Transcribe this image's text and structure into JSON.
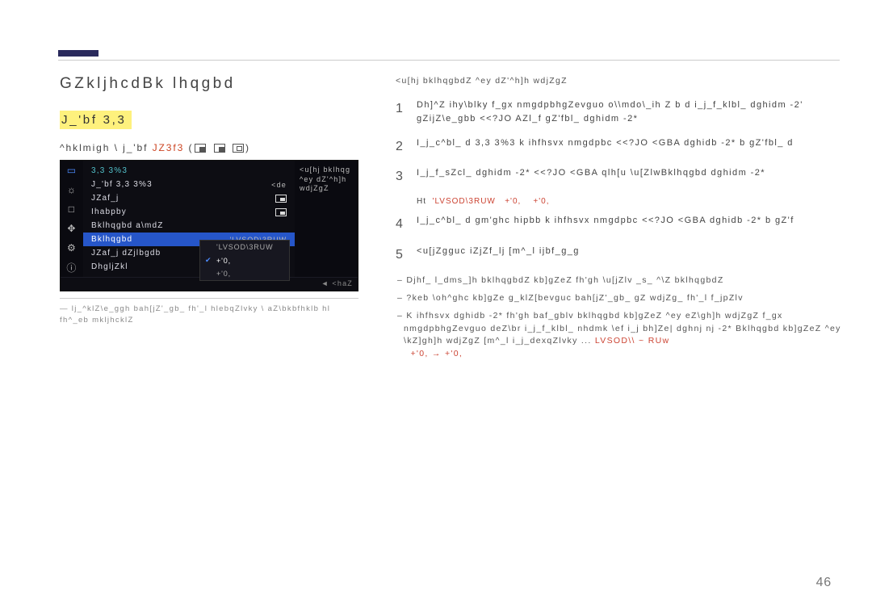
{
  "page": {
    "number": "46"
  },
  "left": {
    "section_title": "GZkljhcdBk lhqgbd",
    "mode_title": "J_'bf 3,3",
    "subtitle_pre": "^hklmigh \\ j_'bf",
    "subtitle_redA": "JZ3f3",
    "subtitle_paren_open": "(",
    "subtitle_paren_close": ")",
    "footnote": "— lj_^klZ\\e_ggh bah[jZ'_gb_ fh'_l hlebqZlvky \\ aZ\\bkbfhklb hl fh^_eb\nmkljhcklZ"
  },
  "osd": {
    "rows": [
      {
        "label": "3,3 3%3",
        "kind": "cyan"
      },
      {
        "label": "J_'bf 3,3 3%3",
        "val": "<de"
      },
      {
        "label": "JZaf_j"
      },
      {
        "label": "Ihabpby"
      },
      {
        "label": "Bklhqgbd a\\mdZ"
      },
      {
        "label": "Bklhqgbd",
        "selected": true,
        "valtxt": "'LVSOD\\3RUW"
      },
      {
        "label": "JZaf_j dZjlbgdb"
      },
      {
        "label": "DhgljZkl"
      }
    ],
    "right_caption": "<u[hj bklhqg\n^ey dZ'^h]h\nwdjZgZ",
    "popup": {
      "r1": "'LVSOD\\3RUW",
      "r2": "+'0,",
      "r3": "+'0,"
    },
    "footer": "◄ <haZ"
  },
  "right": {
    "top_caption": "<u[hj bklhqgbdZ ^ey dZ'^h]h wdjZgZ",
    "rows": [
      {
        "n": "1",
        "t": "Dh]^Z ihy\\blky f_gx nmgdpbhgZevguo o\\\\mdo\\_ih Z   b  d   i_j_f_klbl_ dghidm -2'   gZijZ\\e_gbb <<?JO   AZl_f gZ'fbl_ dghidm -2*"
      },
      {
        "n": "2",
        "t": "I_j_c^bl_ d 3,3 3%3 k ihfhsvx nmgdpbc <<?JO <GBA dghidb -2* b gZ'fbl_ d"
      },
      {
        "n": "3",
        "t": "I_j_f_sZcl_ dghidm -2* <<?JO <GBA qlh[u \\u[ZlwBklhqgbd   dghidm -2*",
        "redpart": "Bklhqgbd"
      },
      {
        "n": "4",
        "t": "I_j_c^bl_ d gm'ghc hipbb k ihfhsvx nmgdpbc <<?JO <GBA dghidb -2* b gZ'f"
      },
      {
        "n": "5",
        "t": "<u[jZgguc iZjZf_lj [m^_l ijbf_g_g"
      }
    ],
    "caption_label": "Ht",
    "caption_red1": "'LVSOD\\3RUW",
    "caption_red2": "+'0,",
    "caption_red3": "+'0,",
    "bullets": [
      "Djhf_ l_dms_]h bklhqgbdZ kb]gZeZ fh'gh \\u[jZlv _s_ ^\\Z bklhqgbdZ",
      "?keb \\oh^ghc kb]gZe g_klZ[bevguc   bah[jZ'_gb_ gZ wdjZg_ fh'_l f_jpZlv",
      "K ihfhsvx dghidb -2* fh'gh baf_gblv bklhqgbd kb]gZeZ ^ey eZ\\gh]h wdjZgZ   f_gx nmgdpbhgZevguo deZ\\br i_j_f_klbl_ nhdmk \\ef    i_j bh]Ze| dghnj nj -2*   Bklhqgbd kb]gZeZ ^ey \\kZ]gh]h wdjZgZ [m^_l i_j_dexqZlvky ...",
      "+'0, → +'0,"
    ],
    "red_in_b3": "LVSOD\\3RUy w ... "
  }
}
